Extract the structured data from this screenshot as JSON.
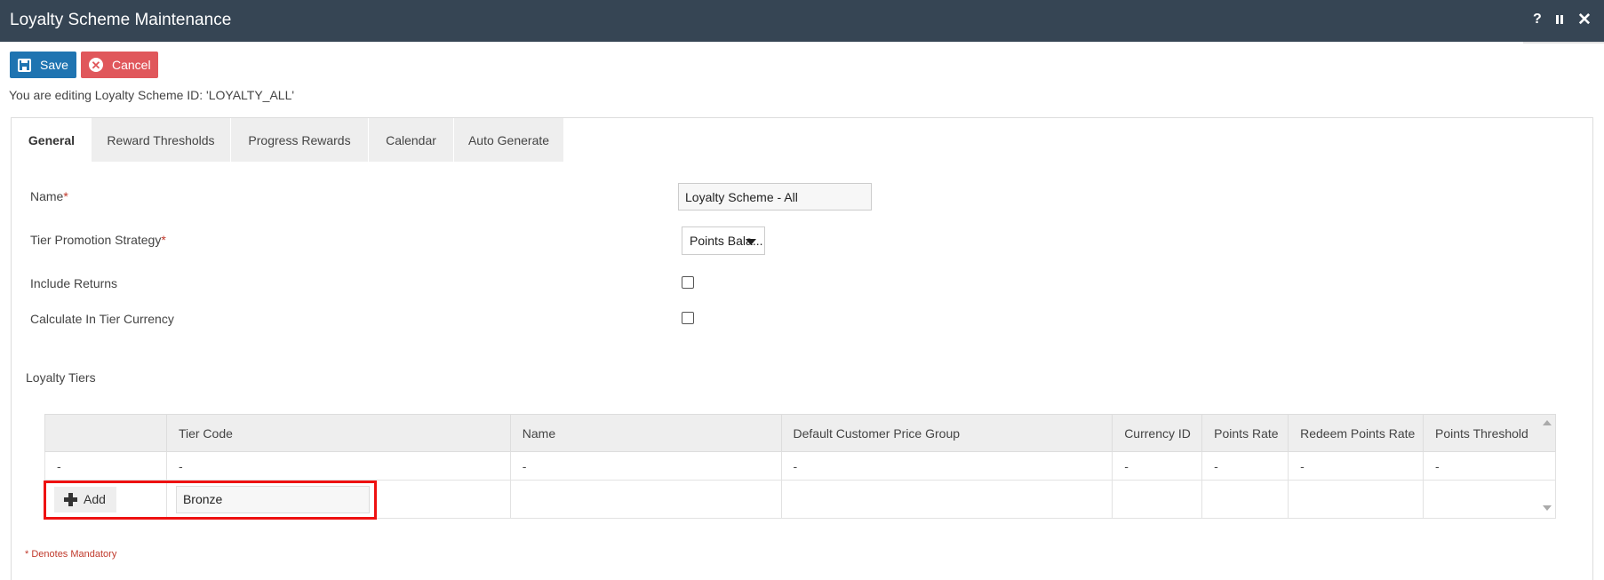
{
  "window": {
    "title": "Loyalty Scheme Maintenance",
    "help_icon": "?",
    "close_icon": "✕"
  },
  "toolbar": {
    "save_label": "Save",
    "cancel_label": "Cancel"
  },
  "editing_text": "You are editing Loyalty Scheme ID: 'LOYALTY_ALL'",
  "tabs": [
    {
      "label": "General",
      "active": true
    },
    {
      "label": "Reward Thresholds",
      "active": false
    },
    {
      "label": "Progress Rewards",
      "active": false
    },
    {
      "label": "Calendar",
      "active": false
    },
    {
      "label": "Auto Generate",
      "active": false
    }
  ],
  "form": {
    "name_label": "Name",
    "name_value": "Loyalty Scheme - All",
    "tier_strategy_label": "Tier Promotion Strategy",
    "tier_strategy_value": "Points Bala...",
    "include_returns_label": "Include Returns",
    "include_returns_checked": false,
    "calc_currency_label": "Calculate In Tier Currency",
    "calc_currency_checked": false,
    "required_marker": "*"
  },
  "tiers": {
    "section_label": "Loyalty Tiers",
    "columns": [
      "",
      "Tier Code",
      "Name",
      "Default Customer Price Group",
      "Currency ID",
      "Points Rate",
      "Redeem Points Rate",
      "Points Threshold"
    ],
    "rows": [
      [
        "-",
        "-",
        "-",
        "-",
        "-",
        "-",
        "-",
        "-"
      ]
    ],
    "add_label": "Add",
    "new_tier_code": "Bronze"
  },
  "footer": {
    "mandatory_note": "* Denotes Mandatory"
  },
  "colors": {
    "titlebar": "#364554",
    "save": "#1f74b1",
    "cancel": "#e0575b",
    "highlight": "#ee1111"
  }
}
